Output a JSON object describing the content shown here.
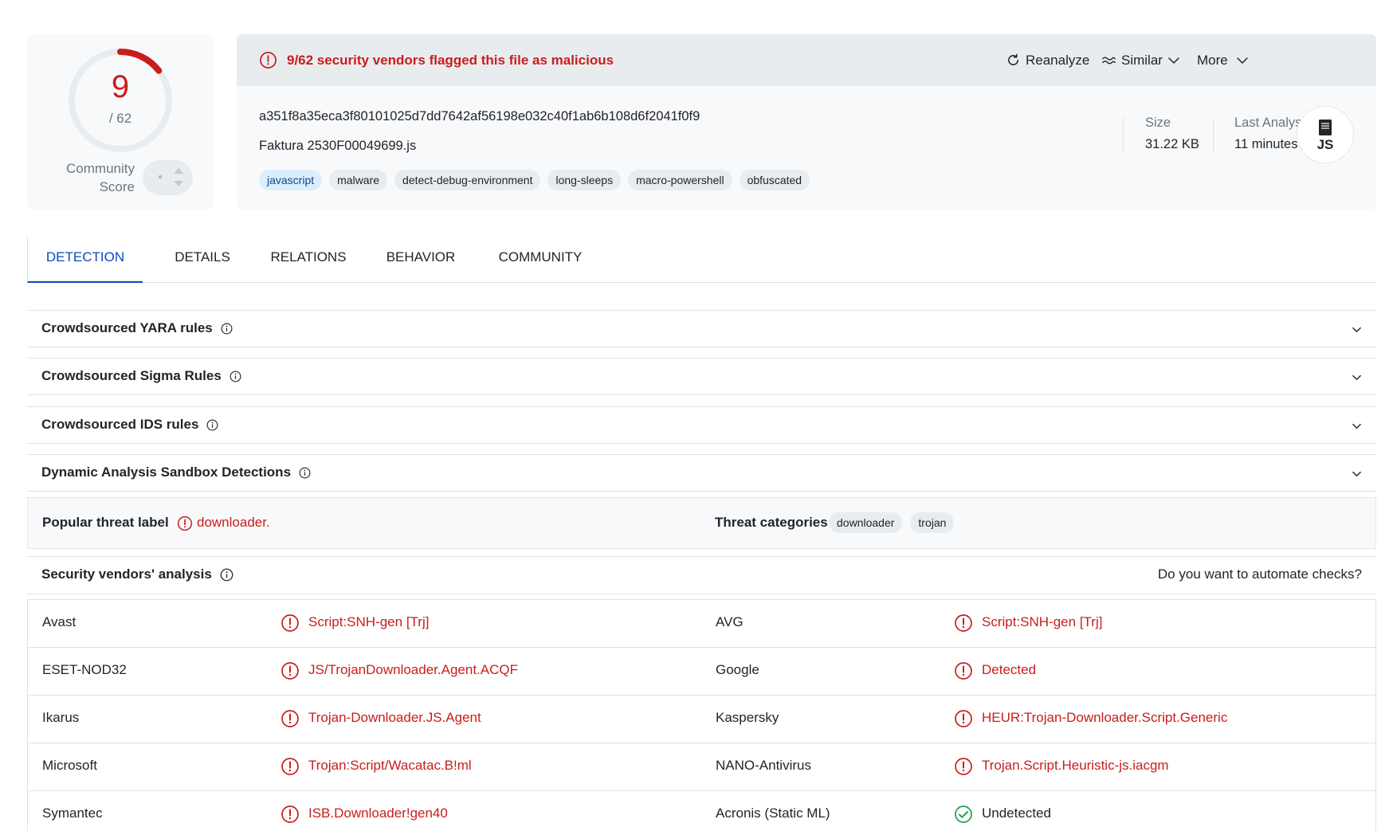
{
  "score": {
    "detected": "9",
    "total": "/ 62",
    "detected_count": 9,
    "total_count": 62,
    "community_label": "Community Score"
  },
  "alert": {
    "text": "9/62 security vendors flagged this file as malicious",
    "reanalyze": "Reanalyze",
    "similar": "Similar",
    "more": "More"
  },
  "file": {
    "hash": "a351f8a35eca3f80101025d7dd7642af56198e032c40f1ab6b108d6f2041f0f9",
    "name": "Faktura 2530F00049699.js",
    "tags": [
      "javascript",
      "malware",
      "detect-debug-environment",
      "long-sleeps",
      "macro-powershell",
      "obfuscated"
    ],
    "size_label": "Size",
    "size_value": "31.22 KB",
    "date_label": "Last Analysis Date",
    "date_value": "11 minutes ago",
    "type_label": "JS"
  },
  "tabs": [
    "DETECTION",
    "DETAILS",
    "RELATIONS",
    "BEHAVIOR",
    "COMMUNITY"
  ],
  "sections": [
    "Crowdsourced YARA rules",
    "Crowdsourced Sigma Rules",
    "Crowdsourced IDS rules",
    "Dynamic Analysis Sandbox Detections"
  ],
  "threat": {
    "label": "Popular threat label",
    "value": "downloader.",
    "categories_label": "Threat categories",
    "categories": [
      "downloader",
      "trojan"
    ]
  },
  "vendors": {
    "title": "Security vendors' analysis",
    "automate": "Do you want to automate checks?",
    "rows": [
      {
        "a_name": "Avast",
        "a_result": "Script:SNH-gen [Trj]",
        "b_name": "AVG",
        "b_result": "Script:SNH-gen [Trj]"
      },
      {
        "a_name": "ESET-NOD32",
        "a_result": "JS/TrojanDownloader.Agent.ACQF",
        "b_name": "Google",
        "b_result": "Detected"
      },
      {
        "a_name": "Ikarus",
        "a_result": "Trojan-Downloader.JS.Agent",
        "b_name": "Kaspersky",
        "b_result": "HEUR:Trojan-Downloader.Script.Generic"
      },
      {
        "a_name": "Microsoft",
        "a_result": "Trojan:Script/Wacatac.B!ml",
        "b_name": "NANO-Antivirus",
        "b_result": "Trojan.Script.Heuristic-js.iacgm"
      },
      {
        "a_name": "Symantec",
        "a_result": "ISB.Downloader!gen40",
        "b_name": "Acronis (Static ML)",
        "b_result": "Undetected"
      }
    ]
  },
  "colors": {
    "malicious": "#c91d1d",
    "clean": "#1e9e4a",
    "accent": "#0b4ab8"
  }
}
